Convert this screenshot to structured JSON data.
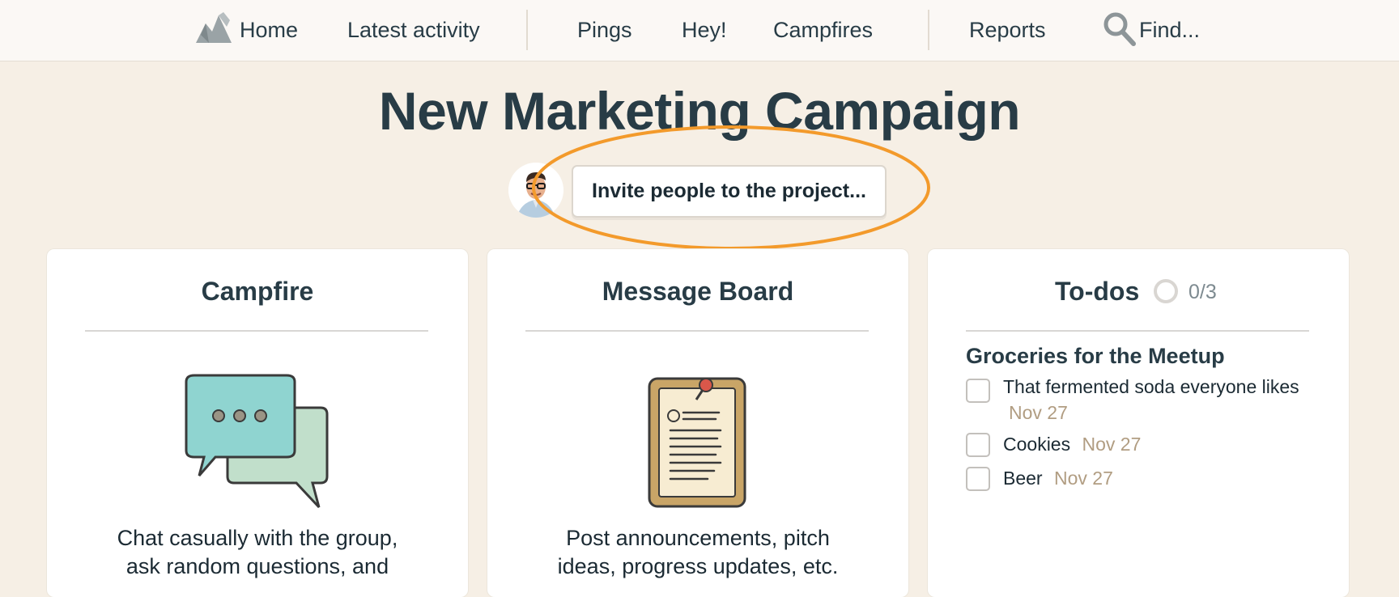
{
  "nav": {
    "home": "Home",
    "latest_activity": "Latest activity",
    "pings": "Pings",
    "hey": "Hey!",
    "campfires": "Campfires",
    "reports": "Reports",
    "find": "Find..."
  },
  "project": {
    "title": "New Marketing Campaign",
    "invite_label": "Invite people to the project..."
  },
  "cards": {
    "campfire": {
      "title": "Campfire",
      "desc_line1": "Chat casually with the group,",
      "desc_line2": "ask random questions, and"
    },
    "message_board": {
      "title": "Message Board",
      "desc_line1": "Post announcements, pitch",
      "desc_line2": "ideas, progress updates, etc."
    },
    "todos": {
      "title": "To-dos",
      "progress": "0/3",
      "list_title": "Groceries for the Meetup",
      "items": [
        {
          "text": "That fermented soda everyone likes",
          "due": "Nov 27"
        },
        {
          "text": "Cookies",
          "due": "Nov 27"
        },
        {
          "text": "Beer",
          "due": "Nov 27"
        }
      ]
    }
  },
  "colors": {
    "background": "#f6efe5",
    "highlight": "#f39a2b",
    "text": "#283c46",
    "due_date": "#b19d82"
  }
}
